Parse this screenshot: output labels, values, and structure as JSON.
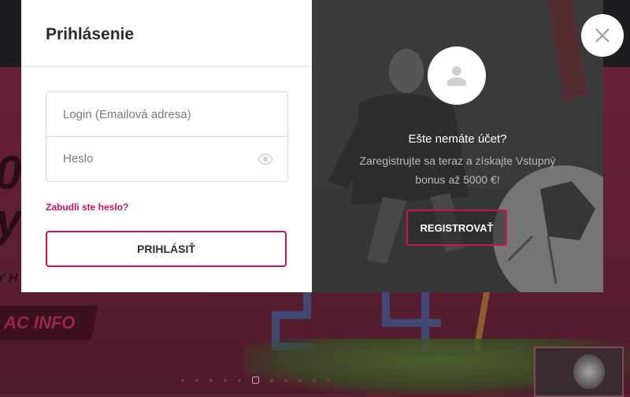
{
  "background": {
    "headline_fragment": "0\ny",
    "letters_fragment": "Y H",
    "info_label": "AC INFO",
    "carousel_dots": 6
  },
  "login": {
    "title": "Prihlásenie",
    "login_placeholder": "Login (Emailová adresa)",
    "password_placeholder": "Heslo",
    "forgot_label": "Zabudli ste heslo?",
    "submit_label": "PRIHLÁSIŤ",
    "show_password_icon": "eye-icon"
  },
  "register": {
    "heading": "Ešte nemáte účet?",
    "text": "Zaregistrujte sa teraz a získajte Vstupný bonus až 5000 €!",
    "button_label": "REGISTROVAŤ",
    "avatar_icon": "user-icon"
  },
  "close_icon": "close-icon",
  "colors": {
    "accent": "#cf1350",
    "panel_dark": "#3f3f41",
    "background_page": "#5a1f33"
  }
}
